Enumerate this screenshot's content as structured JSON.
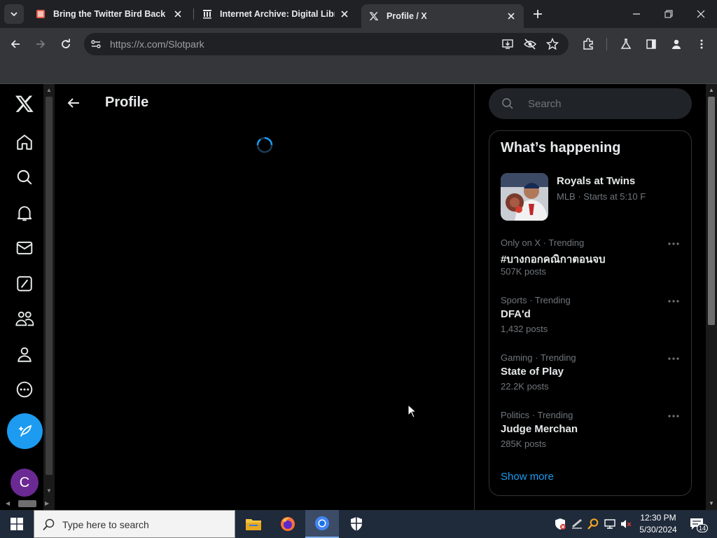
{
  "browser": {
    "tabs": [
      {
        "title": "Bring the Twitter Bird Back",
        "active": false
      },
      {
        "title": "Internet Archive: Digital Librar",
        "active": false
      },
      {
        "title": "Profile / X",
        "active": true
      }
    ],
    "url_host": "https://x.com",
    "url_path": "/Slotpark"
  },
  "page": {
    "header_title": "Profile",
    "nav_icons": [
      "x-logo-icon",
      "home-icon",
      "explore-icon",
      "notifications-icon",
      "messages-icon",
      "grok-icon",
      "communities-icon",
      "profile-icon",
      "more-icon"
    ],
    "avatar_letter": "C",
    "search_placeholder": "Search",
    "trends_title": "What’s happening",
    "event": {
      "name": "Royals at Twins",
      "meta": "MLB · Starts at 5:10 F"
    },
    "trends": [
      {
        "context": "Only on X · Trending",
        "topic": "#บางกอกคณิกาตอนจบ",
        "count": "507K posts"
      },
      {
        "context": "Sports · Trending",
        "topic": "DFA'd",
        "count": "1,432 posts"
      },
      {
        "context": "Gaming · Trending",
        "topic": "State of Play",
        "count": "22.2K posts"
      },
      {
        "context": "Politics · Trending",
        "topic": "Judge Merchan",
        "count": "285K posts"
      }
    ],
    "show_more": "Show more"
  },
  "taskbar": {
    "search_text": "Type here to search",
    "time": "12:30 PM",
    "date": "5/30/2024",
    "notifications": "14"
  },
  "colors": {
    "accent": "#1d9bf0",
    "background": "#000000",
    "muted": "#71767b",
    "avatar": "#6b2a93"
  }
}
